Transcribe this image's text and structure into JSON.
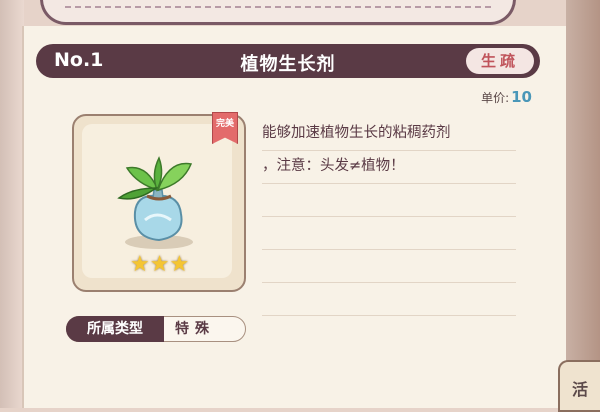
{
  "item": {
    "number": "No.1",
    "name": "植物生长剂",
    "tag": "生疏",
    "price_label": "单价:",
    "price_value": "10",
    "rarity_badge": "完美",
    "stars": 3,
    "description_lines": [
      "能够加速植物生长的粘稠药剂",
      "，注意：头发≠植物！",
      "",
      "",
      "",
      ""
    ],
    "type_label": "所属类型",
    "type_value": "特殊"
  },
  "side_tab": {
    "label": "活"
  },
  "colors": {
    "header_bg": "#5a3a45",
    "tag_text": "#c0535b",
    "price_value": "#4a97b8",
    "star": "#f4c533",
    "badge": "#e36b6b"
  }
}
